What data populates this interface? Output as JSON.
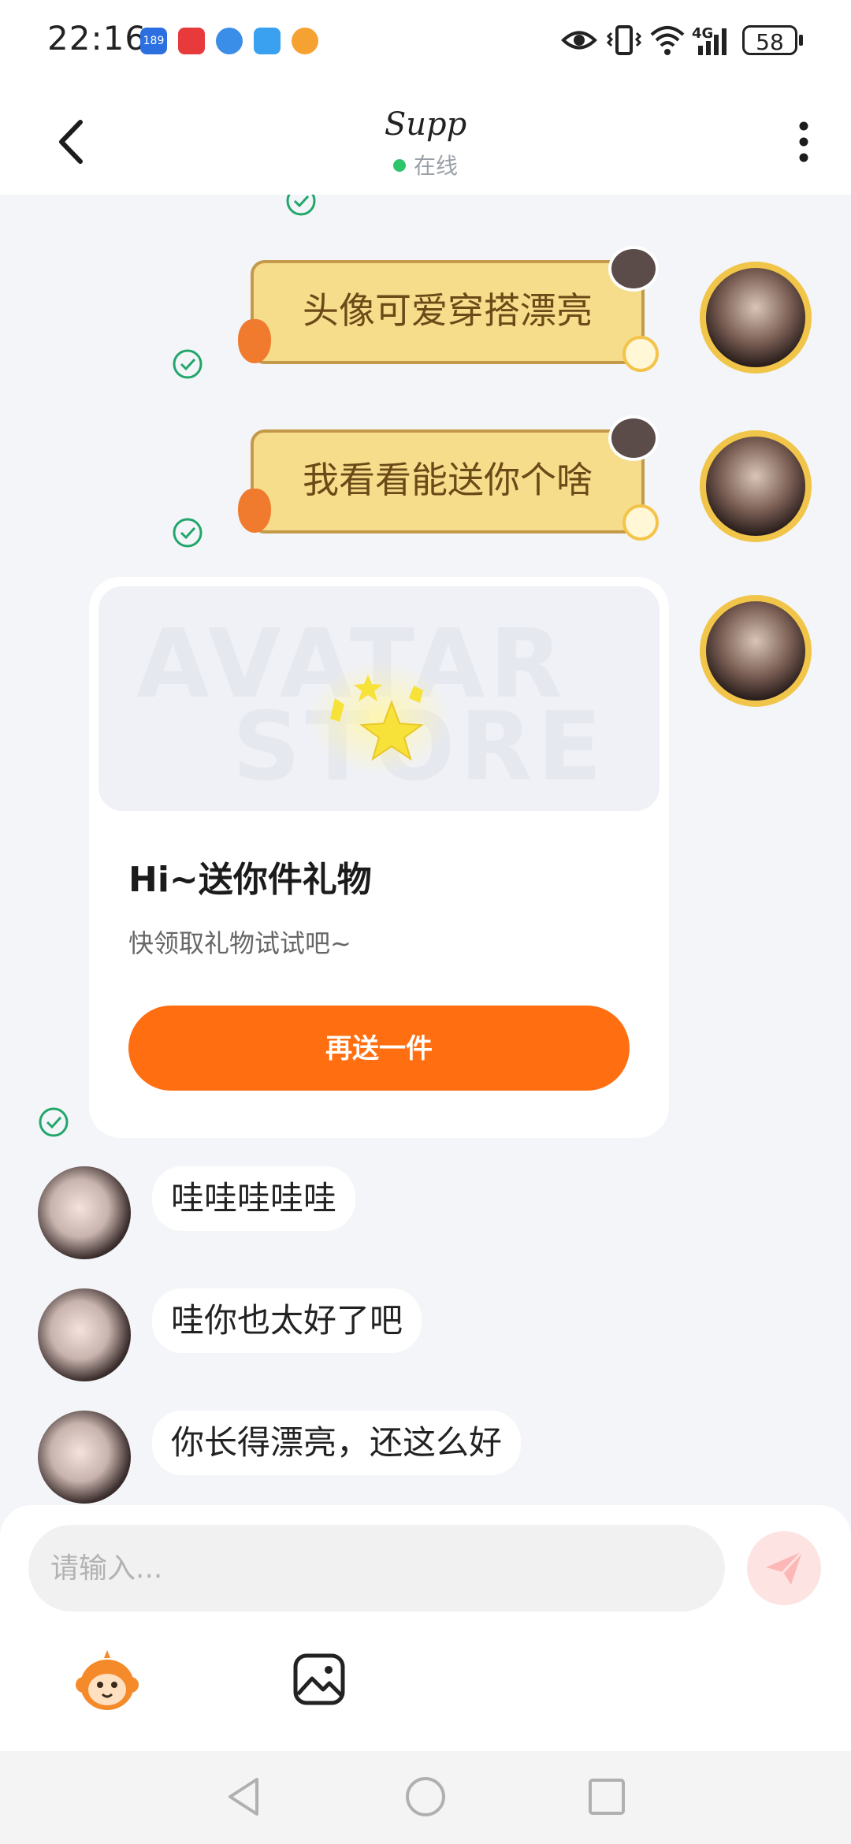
{
  "status_bar": {
    "time": "22:16",
    "notif_badge": "189",
    "network": "4G",
    "battery": "58"
  },
  "header": {
    "title": "Supp",
    "status": "在线",
    "status_color": "#2ec46b"
  },
  "messages_sent": [
    {
      "text": "头像可爱穿搭漂亮"
    },
    {
      "text": "我看看能送你个啥"
    }
  ],
  "gift_card": {
    "watermark_line1": "AVATAR",
    "watermark_line2": "STORE",
    "title": "Hi~送你件礼物",
    "subtitle": "快领取礼物试试吧~",
    "button_label": "再送一件",
    "button_color": "#ff6f12"
  },
  "messages_received": [
    {
      "text": "哇哇哇哇哇"
    },
    {
      "text": "哇你也太好了吧"
    },
    {
      "text": "你长得漂亮，还这么好"
    }
  ],
  "input": {
    "placeholder": "请输入...",
    "value": ""
  },
  "icons": {
    "back": "chevron-left-icon",
    "more": "more-vertical-icon",
    "send": "paper-plane-icon",
    "sticker": "monkey-sticker-icon",
    "image": "image-picker-icon",
    "read": "check-circle-icon"
  }
}
